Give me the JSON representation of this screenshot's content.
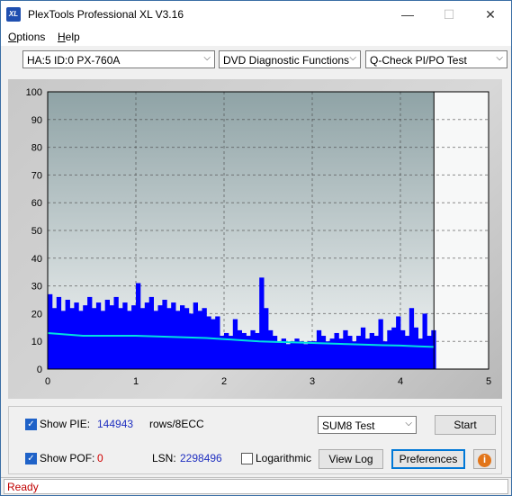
{
  "window": {
    "title": "PlexTools Professional XL V3.16",
    "icon_text": "XL",
    "min_glyph": "—",
    "max_glyph": "☐",
    "close_glyph": "✕"
  },
  "menu": [
    {
      "accel": "O",
      "rest": "ptions"
    },
    {
      "accel": "H",
      "rest": "elp"
    }
  ],
  "toolbar": {
    "drive": "HA:5 ID:0  PX-760A",
    "function": "DVD Diagnostic Functions",
    "test": "Q-Check PI/PO Test",
    "dropdown_glyph": "⌵"
  },
  "chart_data": {
    "type": "bar",
    "y_ticks": [
      0,
      10,
      20,
      30,
      40,
      50,
      60,
      70,
      80,
      90,
      100
    ],
    "x_ticks": [
      0,
      1,
      2,
      3,
      4,
      5
    ],
    "xlim": [
      0,
      5
    ],
    "ylim": [
      0,
      100
    ],
    "data_end_x": 4.38,
    "grid": true,
    "series": [
      {
        "kind": "bar",
        "color": "#0000ff",
        "x": [
          0.0,
          0.05,
          0.1,
          0.15,
          0.2,
          0.25,
          0.3,
          0.35,
          0.4,
          0.45,
          0.5,
          0.55,
          0.6,
          0.65,
          0.7,
          0.75,
          0.8,
          0.85,
          0.9,
          0.95,
          1.0,
          1.05,
          1.1,
          1.15,
          1.2,
          1.25,
          1.3,
          1.35,
          1.4,
          1.45,
          1.5,
          1.55,
          1.6,
          1.65,
          1.7,
          1.75,
          1.8,
          1.85,
          1.9,
          1.95,
          2.0,
          2.05,
          2.1,
          2.15,
          2.2,
          2.25,
          2.3,
          2.35,
          2.4,
          2.45,
          2.5,
          2.55,
          2.6,
          2.65,
          2.7,
          2.75,
          2.8,
          2.85,
          2.9,
          2.95,
          3.0,
          3.05,
          3.1,
          3.15,
          3.2,
          3.25,
          3.3,
          3.35,
          3.4,
          3.45,
          3.5,
          3.55,
          3.6,
          3.65,
          3.7,
          3.75,
          3.8,
          3.85,
          3.9,
          3.95,
          4.0,
          4.05,
          4.1,
          4.15,
          4.2,
          4.25,
          4.3,
          4.35
        ],
        "values": [
          27,
          22,
          26,
          21,
          25,
          22,
          24,
          21,
          23,
          26,
          22,
          24,
          21,
          25,
          23,
          26,
          22,
          24,
          21,
          23,
          31,
          22,
          24,
          26,
          21,
          23,
          25,
          22,
          24,
          21,
          23,
          22,
          20,
          24,
          21,
          22,
          19,
          18,
          19,
          12,
          13,
          12,
          18,
          14,
          13,
          12,
          14,
          13,
          33,
          22,
          14,
          12,
          10,
          11,
          9,
          10,
          11,
          10,
          9,
          10,
          10,
          14,
          12,
          10,
          11,
          13,
          11,
          14,
          12,
          10,
          12,
          15,
          11,
          13,
          12,
          18,
          10,
          14,
          15,
          19,
          14,
          12,
          22,
          15,
          11,
          20,
          12,
          14
        ]
      },
      {
        "kind": "line",
        "color": "#00e0e0",
        "x": [
          0.0,
          0.2,
          0.4,
          0.6,
          0.8,
          1.0,
          1.2,
          1.4,
          1.6,
          1.8,
          2.0,
          2.2,
          2.4,
          2.6,
          2.8,
          3.0,
          3.2,
          3.4,
          3.6,
          3.8,
          4.0,
          4.2,
          4.38
        ],
        "values": [
          13,
          12.5,
          12,
          12,
          12,
          12,
          11.8,
          11.6,
          11.4,
          11.2,
          10.8,
          10.4,
          10,
          9.8,
          9.6,
          9.4,
          9.2,
          9,
          8.8,
          8.6,
          8.5,
          8.2,
          8
        ]
      }
    ]
  },
  "controls": {
    "show_pie_label": "Show PIE:",
    "pie_value": "144943",
    "rows_unit": "rows/8ECC",
    "show_pof_label": "Show POF:",
    "pof_value": "0",
    "lsn_label": "LSN:",
    "lsn_value": "2298496",
    "log_label": "Logarithmic",
    "sum_select": "SUM8 Test",
    "start": "Start",
    "view_log": "View Log",
    "preferences": "Preferences",
    "check_glyph": "✓",
    "info_glyph": "i"
  },
  "colors": {
    "pie_value": "#1f2fc0",
    "pof_value": "#d00000",
    "status_text": "#c00000"
  },
  "status": {
    "text": "Ready"
  }
}
